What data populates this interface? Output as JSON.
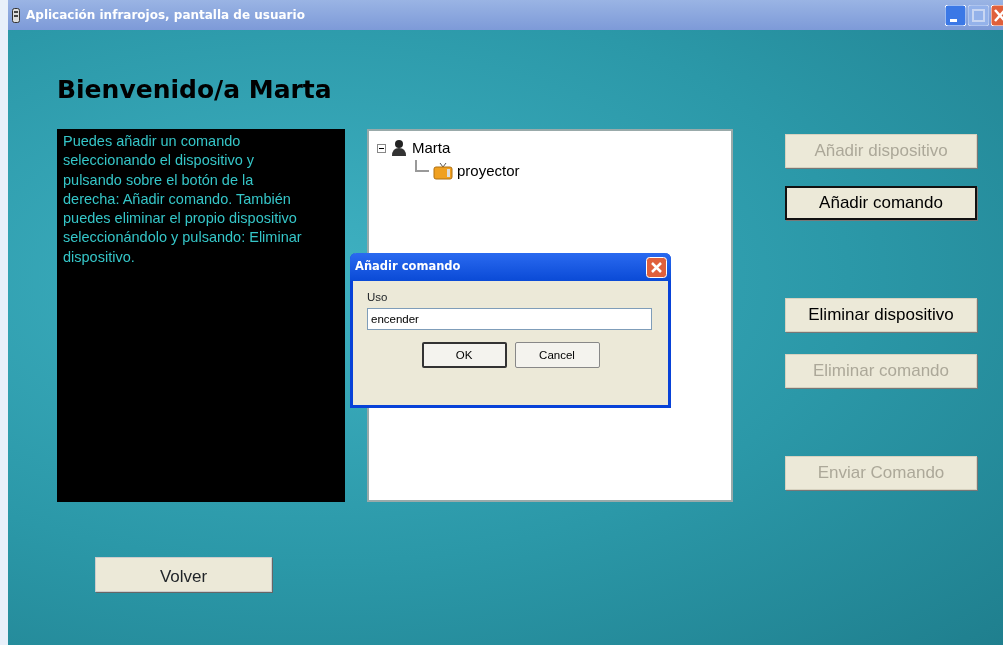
{
  "window": {
    "title": "Aplicación infrarojos, pantalla de usuario"
  },
  "heading": "Bienvenido/a Marta",
  "help_text": "Puedes añadir un comando seleccionando el dispositivo y pulsando sobre el botón de la derecha: Añadir comando. También puedes eliminar el propio dispositivo seleccionándolo y pulsando: Eliminar dispositivo.",
  "tree": [
    {
      "label": "Marta",
      "kind": "user",
      "expanded": true,
      "children": [
        {
          "label": "proyector",
          "kind": "device"
        }
      ]
    }
  ],
  "actions": [
    {
      "label": "Añadir dispositivo",
      "disabled": true,
      "focused": false
    },
    {
      "label": "Añadir comando",
      "disabled": false,
      "focused": true
    },
    {
      "label": "Eliminar dispositivo",
      "disabled": false,
      "focused": false
    },
    {
      "label": "Eliminar comando",
      "disabled": true,
      "focused": false
    },
    {
      "label": "Enviar Comando",
      "disabled": true,
      "focused": false
    }
  ],
  "back_button": "Volver",
  "dialog": {
    "title": "Añadir comando",
    "field_label": "Uso",
    "value": "encender",
    "buttons": [
      {
        "label": "OK",
        "default": true
      },
      {
        "label": "Cancel",
        "default": false
      }
    ]
  }
}
